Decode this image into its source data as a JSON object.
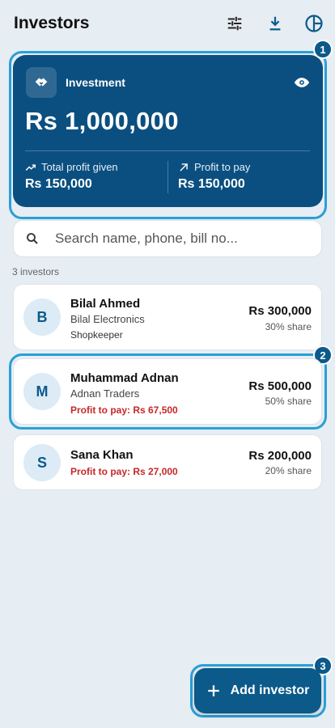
{
  "appbar": {
    "title": "Investors",
    "icons": [
      "filter-sliders-icon",
      "download-icon",
      "pie-chart-icon"
    ]
  },
  "summary": {
    "label": "Investment",
    "amount": "Rs 1,000,000",
    "total_profit_label": "Total profit given",
    "total_profit_value": "Rs 150,000",
    "profit_to_pay_label": "Profit to pay",
    "profit_to_pay_value": "Rs 150,000"
  },
  "search": {
    "placeholder": "Search name, phone, bill no..."
  },
  "list": {
    "count_label": "3 investors",
    "investors": [
      {
        "initial": "B",
        "name": "Bilal Ahmed",
        "business": "Bilal Electronics",
        "role": "Shopkeeper",
        "amount": "Rs 300,000",
        "share": "30% share"
      },
      {
        "initial": "M",
        "name": "Muhammad Adnan",
        "business": "Adnan Traders",
        "profit": "Profit to pay: Rs 67,500",
        "amount": "Rs 500,000",
        "share": "50% share"
      },
      {
        "initial": "S",
        "name": "Sana Khan",
        "profit": "Profit to pay: Rs 27,000",
        "amount": "Rs 200,000",
        "share": "20% share"
      }
    ]
  },
  "fab": {
    "label": "Add investor"
  },
  "badges": [
    "1",
    "2",
    "3"
  ],
  "colors": {
    "primary": "#0b5a8a",
    "card": "#0b4f80",
    "highlight": "#2a9fd6",
    "profit_red": "#c62828"
  }
}
